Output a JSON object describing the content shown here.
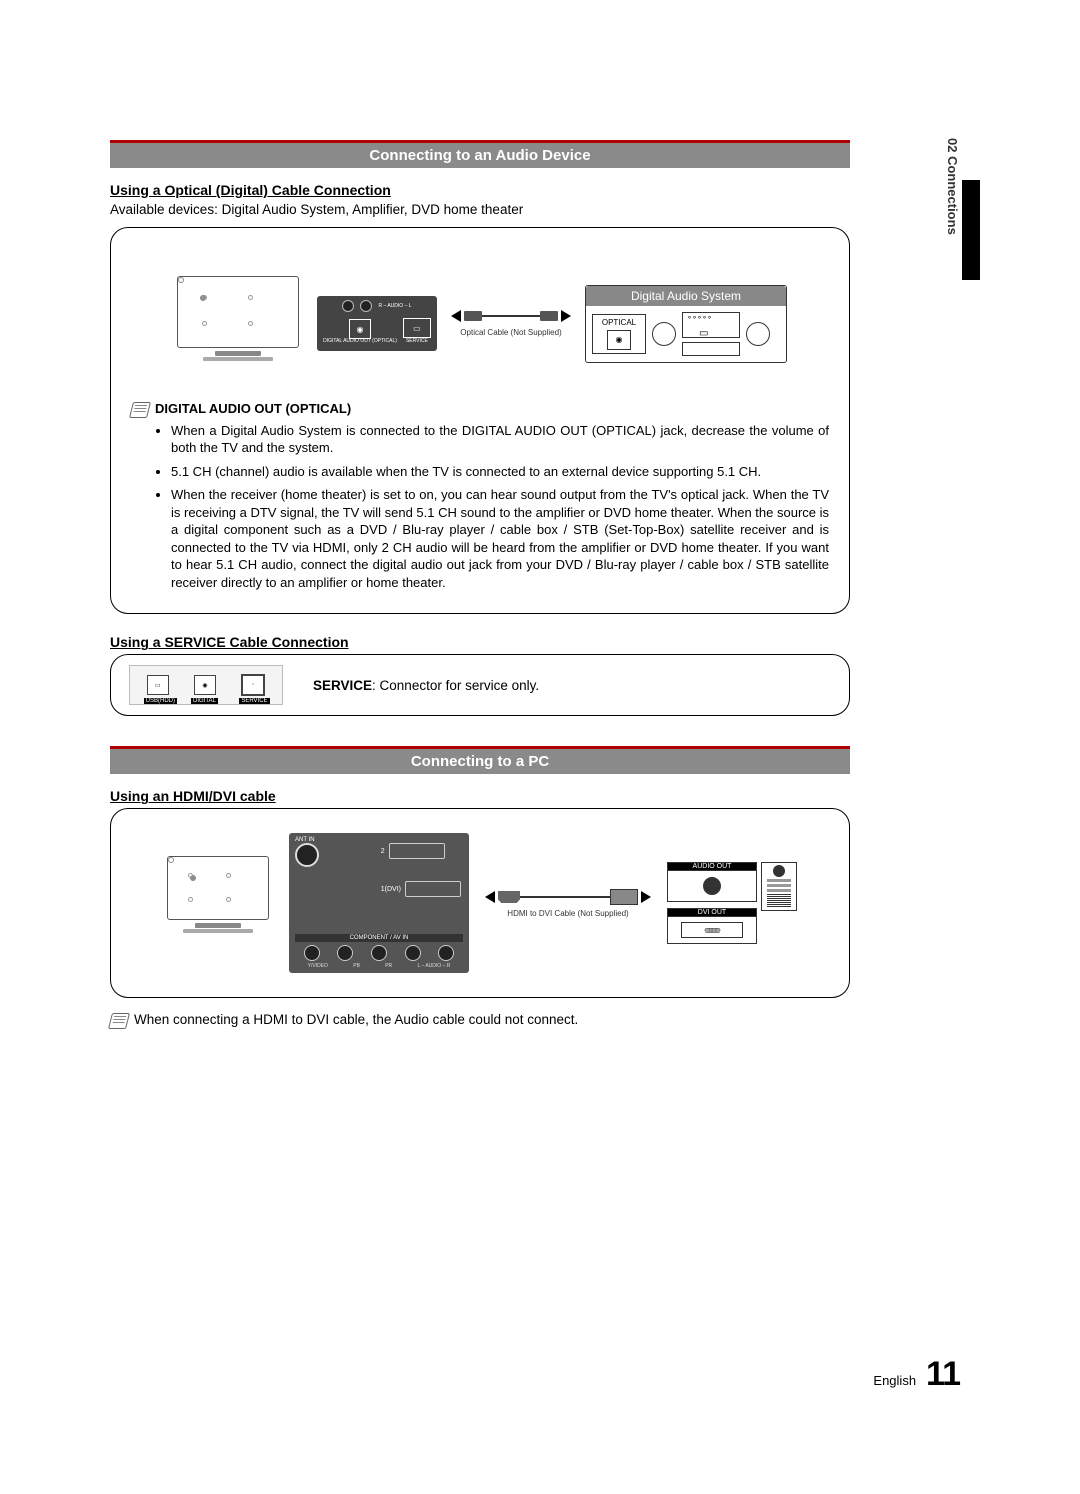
{
  "sideTab": "02    Connections",
  "section1": {
    "header": "Connecting to an Audio Device",
    "sub1": "Using a Optical (Digital) Cable Connection",
    "desc1": "Available devices: Digital Audio System, Amplifier, DVD home theater",
    "diagram": {
      "audioSystemTitle": "Digital Audio System",
      "opticalLabel": "OPTICAL",
      "panelLabels": {
        "digitalAudioOut": "DIGITAL\nAUDIO OUT\n(OPTICAL)",
        "service": "SERVICE",
        "audio": "R – AUDIO – L"
      },
      "cableCaption": "Optical Cable (Not Supplied)"
    },
    "noteHeading": "DIGITAL AUDIO OUT (OPTICAL)",
    "bullets": [
      "When a Digital Audio System is connected to the DIGITAL AUDIO OUT (OPTICAL) jack, decrease the volume of both the TV and the system.",
      "5.1 CH (channel) audio is available when the TV is connected to an external device supporting 5.1 CH.",
      "When the receiver (home theater) is set to on, you can hear sound output from the TV's optical jack. When the TV is receiving a DTV signal, the TV will send 5.1 CH sound to the amplifier or DVD home theater. When the source is a digital component such as a DVD / Blu-ray player / cable box / STB (Set-Top-Box) satellite receiver and is connected to the TV via HDMI, only 2 CH audio will be heard from the amplifier or DVD home theater. If you want to hear 5.1 CH audio, connect the digital audio out jack from your DVD / Blu-ray player / cable box / STB satellite receiver directly to an amplifier or home theater."
    ],
    "sub2": "Using a SERVICE Cable Connection",
    "servicePorts": {
      "usb": "USB(HDD)",
      "digital": "DIGITAL",
      "service": "SERVICE"
    },
    "serviceText": "SERVICE: Connector for service only."
  },
  "section2": {
    "header": "Connecting to a PC",
    "sub1": "Using an HDMI/DVI cable",
    "diagram": {
      "antIn": "ANT IN",
      "hdmi2": "2",
      "hdmi1dvi": "1(DVI)",
      "componentLabel": "COMPONENT / AV IN",
      "compSub": [
        "Y/VIDEO",
        "PB",
        "PR",
        "L – AUDIO – R"
      ],
      "cableCaption": "HDMI to DVI Cable (Not Supplied)",
      "pc": {
        "audioOut": "AUDIO OUT",
        "dviOut": "DVI OUT"
      }
    },
    "noteLine": "When connecting a HDMI to DVI cable, the Audio cable could not connect."
  },
  "footer": {
    "lang": "English",
    "pageNum": "11"
  }
}
